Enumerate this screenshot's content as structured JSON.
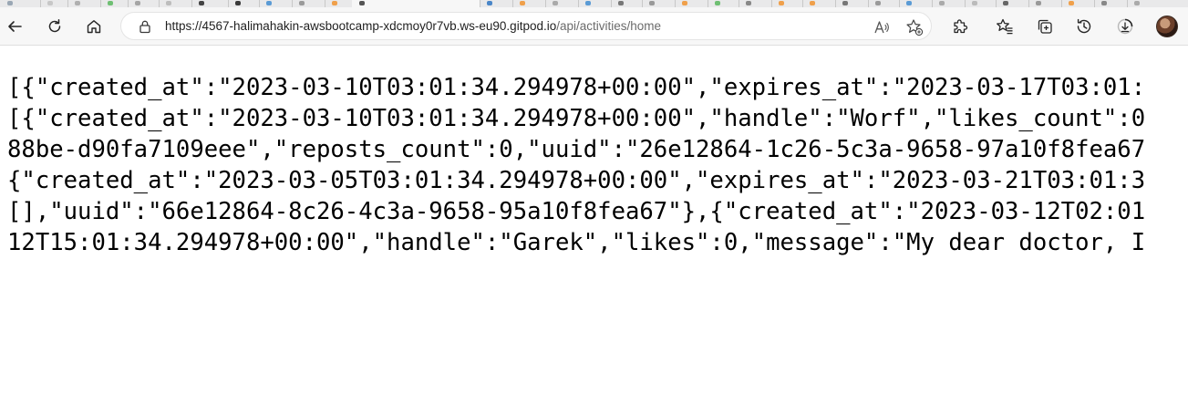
{
  "browser": {
    "address_bar": {
      "url_host": "https://4567-halimahakin-awsbootcamp-xdcmoy0r7vb.ws-eu90.gitpod.io",
      "url_path": "/api/activities/home"
    },
    "icons": {
      "back": "back-arrow-icon",
      "refresh": "refresh-icon",
      "home": "home-icon",
      "lock": "lock-icon",
      "read_aloud": "read-aloud-icon",
      "add_favorite": "add-favorite-icon",
      "extensions": "extensions-icon",
      "favorites": "favorites-icon",
      "collections": "collections-icon",
      "history": "history-icon",
      "downloads": "downloads-icon",
      "profile": "profile-avatar"
    },
    "colors": {
      "toolbar_bg": "#f7f7f7",
      "tabstrip_bg": "#e9e9ea",
      "url_path": "#6b6b6b",
      "text": "#000000"
    }
  },
  "page": {
    "json_lines": [
      "[{\"created_at\":\"2023-03-10T03:01:34.294978+00:00\",\"expires_at\":\"2023-03-17T03:01:",
      "[{\"created_at\":\"2023-03-10T03:01:34.294978+00:00\",\"handle\":\"Worf\",\"likes_count\":0",
      "88be-d90fa7109eee\",\"reposts_count\":0,\"uuid\":\"26e12864-1c26-5c3a-9658-97a10f8fea67",
      "{\"created_at\":\"2023-03-05T03:01:34.294978+00:00\",\"expires_at\":\"2023-03-21T03:01:3",
      "[],\"uuid\":\"66e12864-8c26-4c3a-9658-95a10f8fea67\"},{\"created_at\":\"2023-03-12T02:01",
      "12T15:01:34.294978+00:00\",\"handle\":\"Garek\",\"likes\":0,\"message\":\"My dear doctor, I"
    ]
  }
}
